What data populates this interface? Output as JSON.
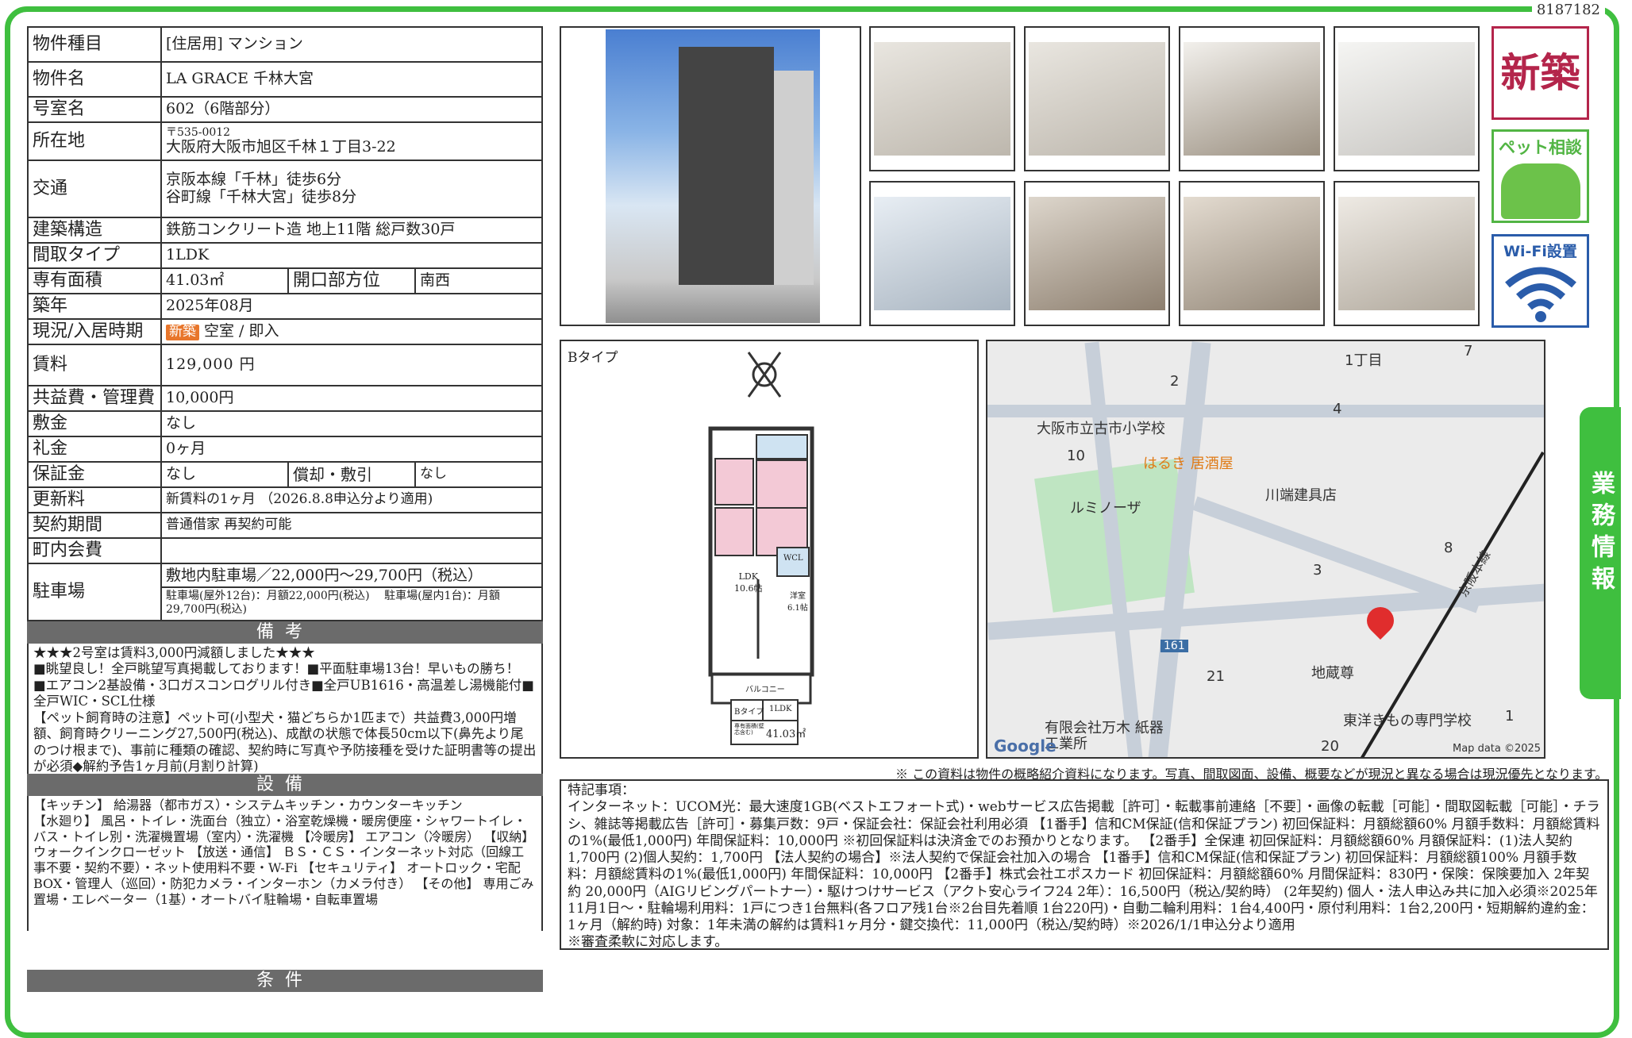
{
  "document_id": "8187182",
  "info": {
    "rows": [
      {
        "label": "物件種目",
        "value": "[住居用] マンション"
      },
      {
        "label": "物件名",
        "value": "LA GRACE 千林大宮"
      },
      {
        "label": "号室名",
        "value": "602（6階部分）"
      },
      {
        "label": "所在地",
        "postal": "〒535-0012",
        "value": "大阪府大阪市旭区千林１丁目3-22"
      },
      {
        "label": "交通",
        "line1": "京阪本線「千林」徒歩6分",
        "line2": "谷町線「千林大宮」徒歩8分"
      },
      {
        "label": "建築構造",
        "value": "鉄筋コンクリート造 地上11階 総戸数30戸"
      },
      {
        "label": "間取タイプ",
        "value": "1LDK"
      },
      {
        "label": "専有面積",
        "value": "41.03㎡",
        "label2": "開口部方位",
        "value2": "南西"
      },
      {
        "label": "築年",
        "value": "2025年08月"
      },
      {
        "label": "現況/入居時期",
        "tag": "新築",
        "value": "空室 / 即入"
      },
      {
        "label": "賃料",
        "value": "129,000 円"
      },
      {
        "label": "共益費・管理費",
        "value": "10,000円"
      },
      {
        "label": "敷金",
        "value": "なし"
      },
      {
        "label": "礼金",
        "value": "0ヶ月"
      },
      {
        "label": "保証金",
        "value": "なし",
        "label2": "償却・敷引",
        "value2": "なし"
      },
      {
        "label": "更新料",
        "value": "新賃料の1ヶ月 （2026.8.8申込分より適用)"
      },
      {
        "label": "契約期間",
        "value": "普通借家 再契約可能"
      },
      {
        "label": "町内会費",
        "value": ""
      },
      {
        "label": "駐車場",
        "value": "敷地内駐車場／22,000円～29,700円（税込）",
        "detail": "駐車場(屋外12台)：月額22,000円(税込)　 駐車場(屋内1台)：月額29,700円(税込)"
      }
    ]
  },
  "biko": {
    "header": "備考",
    "text": "★★★2号室は賃料3,000円減額しました★★★\n■眺望良し！全戸眺望写真掲載しております！■平面駐車場13台！早いもの勝ち！\n■エアコン2基設備・3口ガスコンログリル付き■全戸UB1616・高温差し湯機能付■全戸WIC・SCL仕様\n【ペット飼育時の注意】ペット可(小型犬・猫どちらか1匹まで）共益費3,000円増額、飼育時クリーニング27,500円(税込)、成猷の状態で体長50cm以下(鼻先より尾のつけ根まで)、事前に種類の確認、契約時に写真や予防接種を受けた証明書等の提出が必須◆解約予告1ヶ月前(月割り計算)"
  },
  "setsubi": {
    "header": "設備",
    "text": "【キッチン】 給湯器（都市ガス）・システムキッチン・カウンターキッチン\n【水廻り】 風呂・トイレ・洗面台（独立）・浴室乾燥機・暖房便座・シャワートイレ・バス・トイレ別・洗濯機置場（室内）・洗濯機 【冷暖房】 エアコン（冷暖房） 【収納】 ウォークインクローゼット 【放送・通信】 ＢＳ・ＣＳ・インターネット対応（回線工事不要・契約不要）・ネット使用料不要・W-Fi 【セキュリティ】 オートロック・宅配BOX・管理人（巡回）・防犯カメラ・インターホン（カメラ付き） 【その他】 専用ごみ置場・エレベーター（1基）・オートバイ駐輪場・自転車置場"
  },
  "jouken": {
    "header": "条件"
  },
  "badges": {
    "new_label": "新築",
    "pet_label": "ペット相談",
    "wifi_label": "Wi-Fi設置"
  },
  "side_tab": "業務情報",
  "floorplan": {
    "type_label": "Bタイプ",
    "ldk_label": "LDK\n10.6帖",
    "room_label": "洋室\n6.1帖",
    "balcony_label": "バルコニー",
    "wcl_label": "WCL",
    "legend_type": "Bタイプ",
    "legend_layout": "1LDK",
    "legend_area_label": "専有面積(壁芯含む)",
    "legend_area": "41.03㎡"
  },
  "map": {
    "labels": [
      "1丁目",
      "7",
      "2",
      "4",
      "大阪市立古市小学校",
      "10",
      "はるき 居酒屋",
      "川端建具店",
      "ルミノーザ",
      "8",
      "3",
      "161",
      "京阪本線",
      "地蔵尊",
      "21",
      "有限会社万木 紙器工業所",
      "東洋きもの専門学校",
      "1",
      "20"
    ],
    "google": "Google",
    "copyright": "Map data ©2025"
  },
  "note": "※ この資料は物件の概略紹介資料になります。写真、間取図面、設備、概要などが現況と異なる場合は現況優先となります。",
  "tokki": {
    "text": "特記事項：\nインターネット：UCOM光：最大速度1GB(ベストエフォート式)・webサービス広告掲載［許可］・転載事前連絡［不要］・画像の転載［可能］・間取図転載［可能］・チラシ、雑誌等掲載広告［許可］・募集戸数：9戸・保証会社：保証会社利用必須 【1番手】信和CM保証(信和保証プラン) 初回保証料：月額総額60% 月額手数料：月額総賃料の1%(最低1,000円) 年間保証料：10,000円 ※初回保証料は決済金でのお預かりとなります。 【2番手】全保連 初回保証料：月額総額60% 月額保証料：(1)法人契約1,700円 (2)個人契約：1,700円 【法人契約の場合】※法人契約で保証会社加入の場合 【1番手】信和CM保証(信和保証プラン) 初回保証料：月額総額100% 月額手数料：月額総賃料の1%(最低1,000円) 年間保証料：10,000円 【2番手】株式会社エポスカード 初回保証料：月額総額60% 月間保証料：830円・保険：保険要加入 2年契約 20,000円（AIGリビングパートナー）・駆けつけサービス（アクト安心ライフ24 2年）：16,500円（税込/契約時） (2年契約) 個人・法人申込み共に加入必須※2025年11月1日～・駐輪場利用料：1戸につき1台無料(各フロア残1台※2台目先着順 1台220円)・自動二輪利用料：1台4,400円・原付利用料：1台2,200円・短期解約違約金：1ヶ月（解約時) 対象：1年未満の解約は賃料1ヶ月分・鍵交換代：11,000円（税込/契約時）※2026/1/1申込分より適用\n※審査柔軟に対応します。"
  }
}
